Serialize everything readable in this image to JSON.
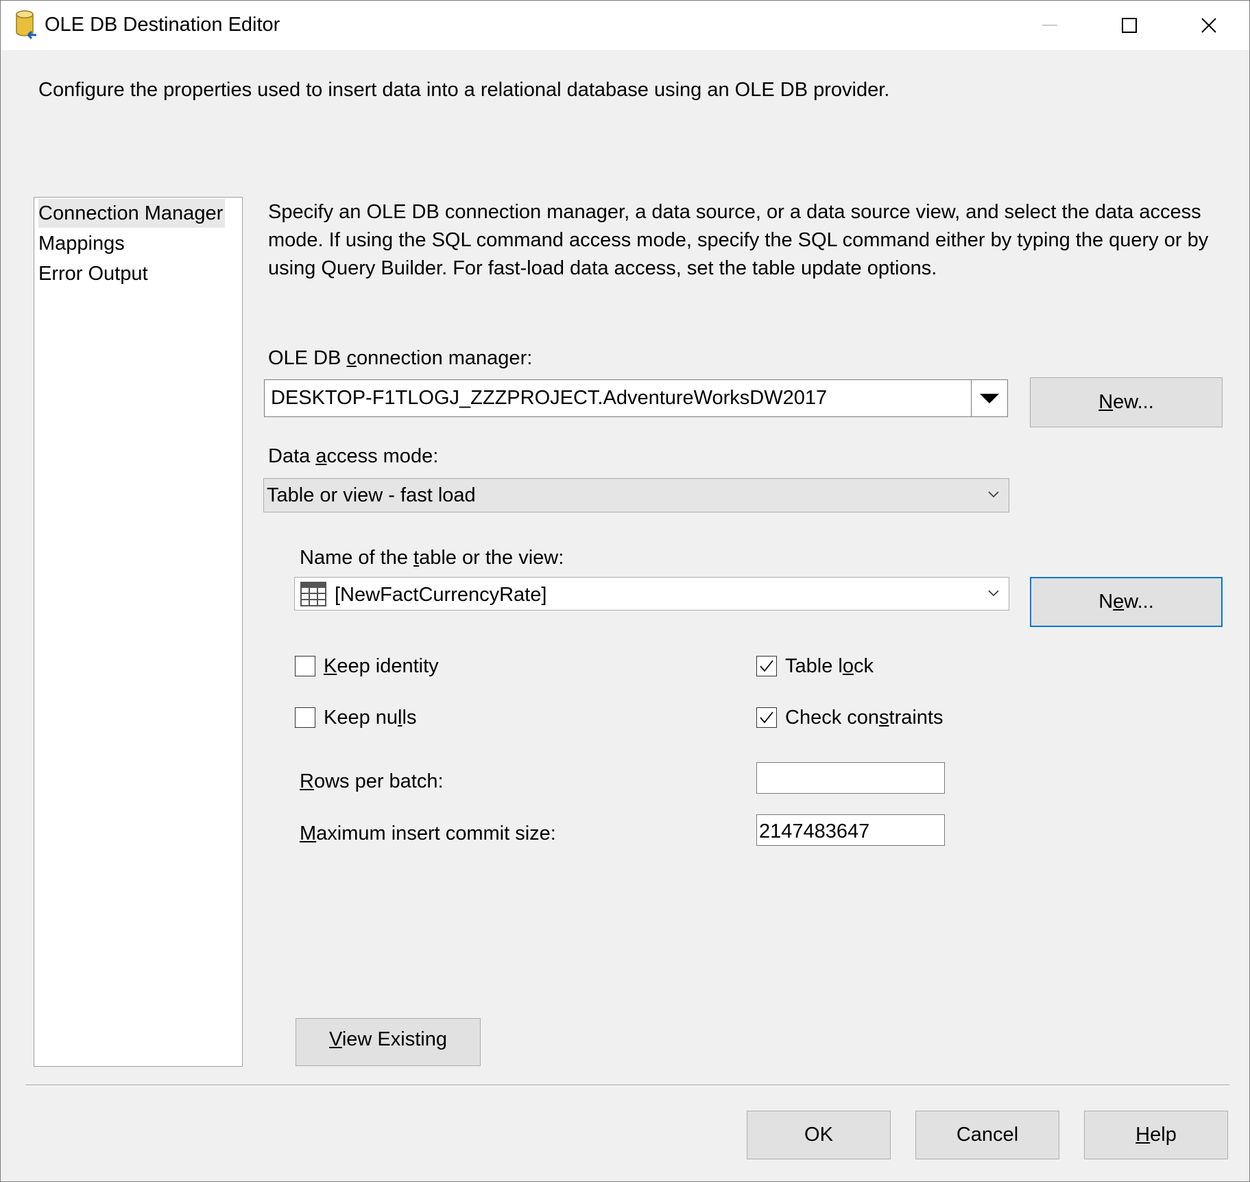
{
  "window": {
    "title": "OLE DB Destination Editor",
    "controls": [
      "minimize-icon",
      "maximize-icon",
      "close-icon"
    ]
  },
  "description": "Configure the properties used to insert data into a relational database using an OLE DB provider.",
  "nav": {
    "items": [
      {
        "label": "Connection Manager",
        "selected": true
      },
      {
        "label": "Mappings",
        "selected": false
      },
      {
        "label": "Error Output",
        "selected": false
      }
    ]
  },
  "panel": {
    "instructions": "Specify an OLE DB connection manager, a data source, or a data source view, and select the data access mode. If using the SQL command access mode, specify the SQL command either by typing the query or by using Query Builder. For fast-load data access, set the table update options.",
    "connection_manager": {
      "label_pre": "OLE DB ",
      "label_accel": "c",
      "label_post": "onnection manager:",
      "value": "DESKTOP-F1TLOGJ_ZZZPROJECT.AdventureWorksDW2017",
      "new_button": {
        "accel": "N",
        "rest": "ew..."
      }
    },
    "access_mode": {
      "label_pre": "Data ",
      "label_accel": "a",
      "label_post": "ccess mode:",
      "value": "Table or view - fast load"
    },
    "table": {
      "label_pre": "Name of the ",
      "label_accel": "t",
      "label_post": "able or the view:",
      "value": "[NewFactCurrencyRate]",
      "icon": "table-icon",
      "new_button": {
        "pre": "N",
        "accel": "e",
        "rest": "w..."
      }
    },
    "options": {
      "keep_identity": {
        "accel": "K",
        "rest": "eep identity",
        "checked": false
      },
      "keep_nulls": {
        "pre": "Keep nu",
        "accel": "l",
        "rest": "ls",
        "checked": false
      },
      "table_lock": {
        "pre": "Table l",
        "accel": "o",
        "rest": "ck",
        "checked": true
      },
      "check_constraints": {
        "pre": "Check con",
        "accel": "s",
        "rest": "traints",
        "checked": true
      }
    },
    "rows_per_batch": {
      "accel": "R",
      "rest": "ows per batch:",
      "value": ""
    },
    "max_commit": {
      "accel": "M",
      "rest": "aximum insert commit size:",
      "value": "2147483647"
    },
    "view_existing": {
      "accel": "V",
      "rest": "iew Existing"
    }
  },
  "footer": {
    "ok": "OK",
    "cancel": "Cancel",
    "help": {
      "accel": "H",
      "rest": "elp"
    }
  }
}
